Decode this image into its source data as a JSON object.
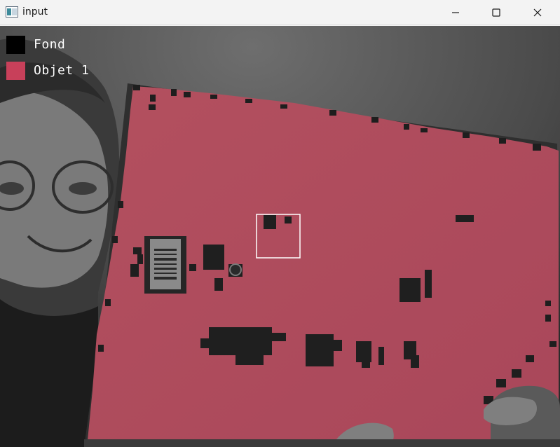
{
  "window": {
    "title": "input",
    "icon": "app-window-icon",
    "controls": [
      "minimize-icon",
      "maximize-icon",
      "close-icon"
    ]
  },
  "legend": [
    {
      "label": "Fond",
      "color": "#000000"
    },
    {
      "label": "Objet 1",
      "color": "#c8405a"
    }
  ],
  "overlay": {
    "object_color": "#b84a5e",
    "background_color": "#000000"
  }
}
